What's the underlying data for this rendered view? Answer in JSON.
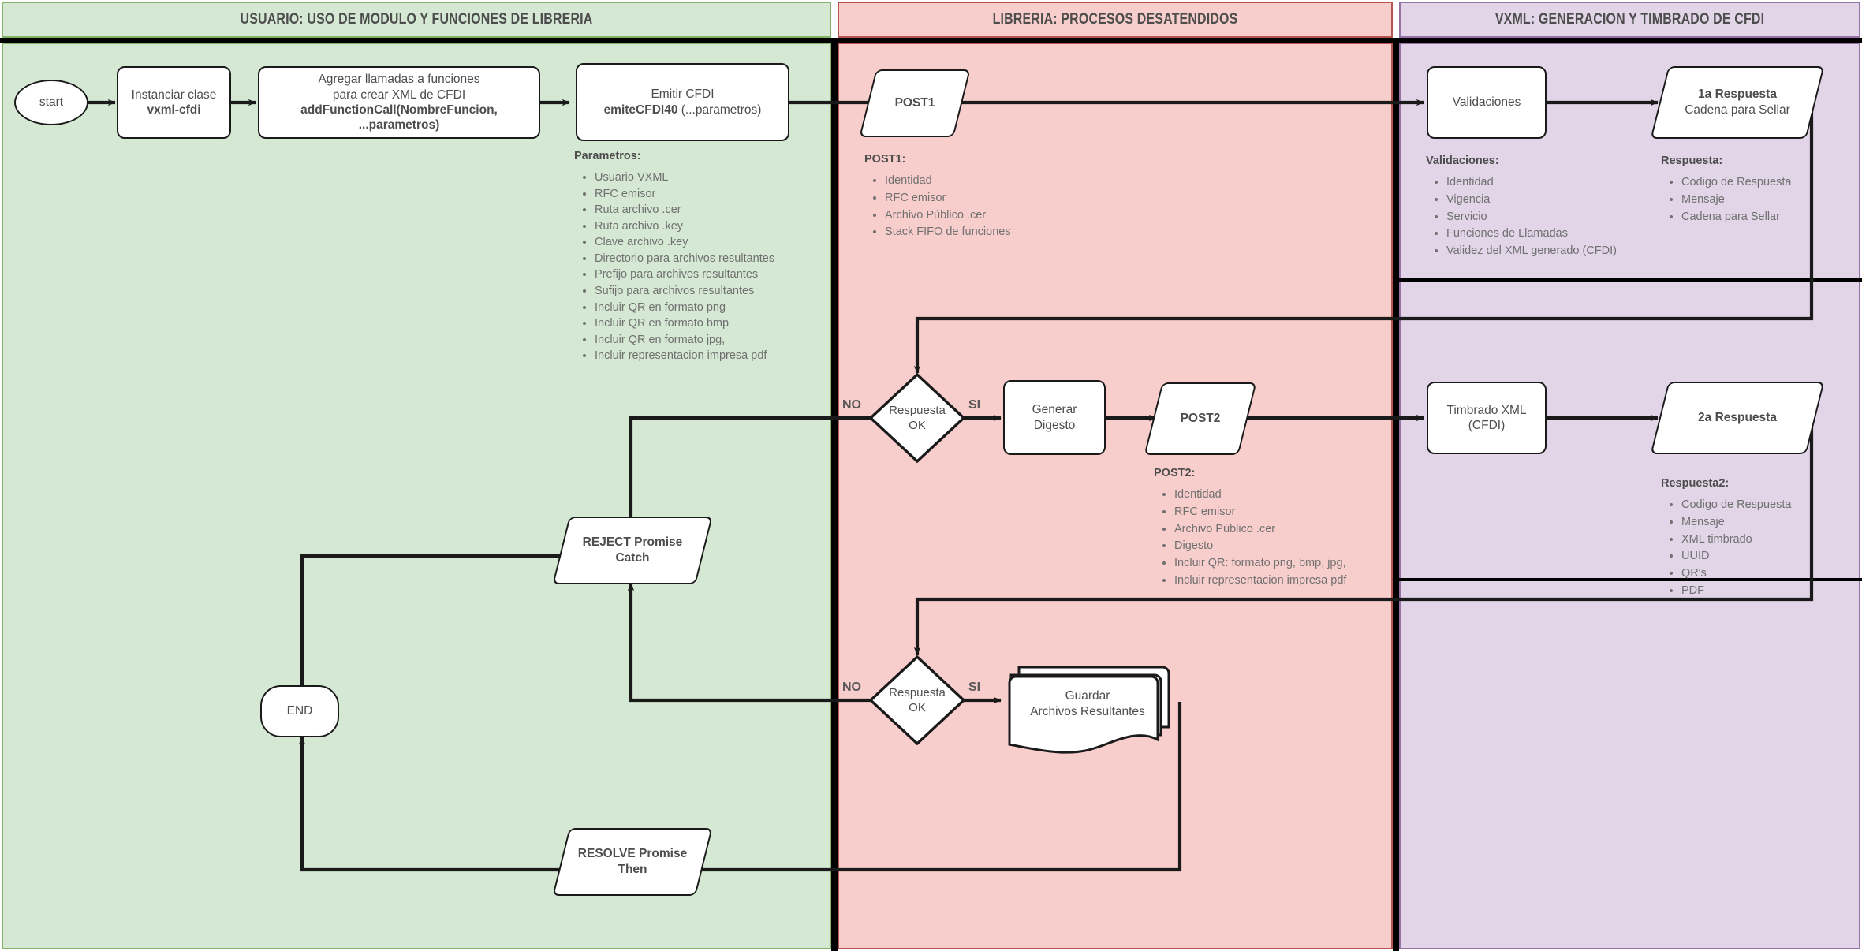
{
  "lanes": [
    {
      "id": "usuario",
      "title": "USUARIO: USO DE MODULO Y FUNCIONES DE LIBRERIA",
      "color": "#d5e8d4",
      "border": "#82b366"
    },
    {
      "id": "libreria",
      "title": "LIBRERIA: PROCESOS DESATENDIDOS",
      "color": "#f8cecc",
      "border": "#b85450"
    },
    {
      "id": "vxml",
      "title": "VXML: GENERACION Y TIMBRADO DE CFDI",
      "color": "#e1d5e7",
      "border": "#9673a6"
    }
  ],
  "nodes": {
    "start": {
      "label": "start"
    },
    "instanciar": {
      "line1": "Instanciar clase",
      "line2": "vxml-cfdi"
    },
    "agregar": {
      "line1": "Agregar llamadas a funciones",
      "line2": "para crear XML de CFDI",
      "line3": "addFunctionCall(NombreFuncion, ...parametros)"
    },
    "emitir": {
      "line1": "Emitir CFDI",
      "line2": "emiteCFDI40",
      "line3": " (...parametros)"
    },
    "post1": {
      "label": "POST1"
    },
    "post2": {
      "label": "POST2"
    },
    "validaciones": {
      "label": "Validaciones"
    },
    "respuesta1": {
      "line1": "1a Respuesta",
      "line2": "Cadena para Sellar"
    },
    "respuesta2": {
      "line1": "2a Respuesta"
    },
    "decision1": {
      "line1": "Respuesta",
      "line2": "OK"
    },
    "decision2": {
      "line1": "Respuesta",
      "line2": "OK"
    },
    "generar_digesto": {
      "line1": "Generar",
      "line2": "Digesto"
    },
    "timbrado": {
      "line1": "Timbrado XML",
      "line2": "(CFDI)"
    },
    "guardar": {
      "line1": "Guardar",
      "line2": "Archivos Resultantes"
    },
    "reject": {
      "line1": "REJECT Promise",
      "line2": "Catch"
    },
    "resolve": {
      "line1": "RESOLVE Promise",
      "line2": "Then"
    },
    "end": {
      "label": "END"
    }
  },
  "edge_labels": {
    "no1": "NO",
    "si1": "SI",
    "no2": "NO",
    "si2": "SI"
  },
  "annotations": {
    "parametros": {
      "head": "Parametros:",
      "items": [
        "Usuario VXML",
        "RFC emisor",
        "Ruta archivo .cer",
        "Ruta archivo .key",
        "Clave archivo .key",
        "Directorio para archivos resultantes",
        "Prefijo para archivos resultantes",
        "Sufijo  para archivos resultantes",
        "Incluir QR en formato png",
        "Incluir QR en formato bmp",
        "Incluir QR en formato jpg,",
        "Incluir representacion impresa pdf"
      ]
    },
    "post1": {
      "head": "POST1:",
      "items": [
        "Identidad",
        "RFC emisor",
        "Archivo Público .cer",
        "Stack FIFO de funciones"
      ]
    },
    "post2": {
      "head": "POST2:",
      "items": [
        "Identidad",
        "RFC emisor",
        "Archivo Público .cer",
        "Digesto",
        "Incluir QR: formato png, bmp, jpg,",
        "Incluir representacion impresa pdf"
      ]
    },
    "validaciones": {
      "head": "Validaciones:",
      "items": [
        "Identidad",
        "Vigencia",
        "Servicio",
        "Funciones de Llamadas",
        "Validez del XML generado (CFDI)"
      ]
    },
    "respuesta": {
      "head": "Respuesta:",
      "items": [
        "Codigo de Respuesta",
        "Mensaje",
        "Cadena para Sellar"
      ]
    },
    "respuesta2": {
      "head": "Respuesta2:",
      "items": [
        "Codigo de Respuesta",
        "Mensaje",
        "XML timbrado",
        "UUID",
        "QR's",
        "PDF"
      ]
    }
  }
}
